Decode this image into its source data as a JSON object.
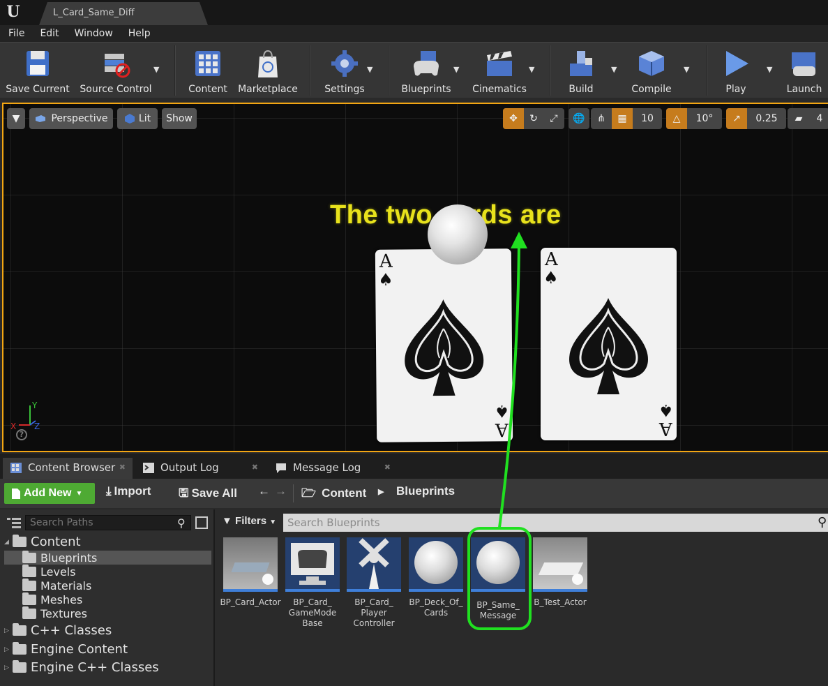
{
  "window": {
    "doc_tab": "L_Card_Same_Diff"
  },
  "menu": [
    "File",
    "Edit",
    "Window",
    "Help"
  ],
  "toolbar": {
    "save_current": "Save Current",
    "source_control": "Source Control",
    "content": "Content",
    "marketplace": "Marketplace",
    "settings": "Settings",
    "blueprints": "Blueprints",
    "cinematics": "Cinematics",
    "build": "Build",
    "compile": "Compile",
    "play": "Play",
    "launch": "Launch"
  },
  "viewport": {
    "perspective": "Perspective",
    "lit": "Lit",
    "show": "Show",
    "grid_snap": "10",
    "rot_snap": "10°",
    "scale_snap": "0.25",
    "cam_speed": "4",
    "world_text": "The two cards are",
    "card_left_rank": "A",
    "card_right_rank": "A",
    "axis_x": "X",
    "axis_y": "Y",
    "axis_z": "Z",
    "help": "?"
  },
  "panel_tabs": [
    "Content Browser",
    "Output Log",
    "Message Log"
  ],
  "cb_toolbar": {
    "add_new": "Add New",
    "import": "Import",
    "save_all": "Save All",
    "path": [
      "Content",
      "Blueprints"
    ]
  },
  "sources": {
    "search_placeholder": "Search Paths",
    "tree": [
      "Content",
      "Blueprints",
      "Levels",
      "Materials",
      "Meshes",
      "Textures",
      "C++ Classes",
      "Engine Content",
      "Engine C++ Classes"
    ]
  },
  "assets": {
    "filters": "Filters",
    "search_placeholder": "Search Blueprints",
    "items": [
      {
        "l1": "BP_Card_Actor",
        "l2": "",
        "l3": ""
      },
      {
        "l1": "BP_Card_",
        "l2": "GameMode",
        "l3": "Base"
      },
      {
        "l1": "BP_Card_",
        "l2": "Player",
        "l3": "Controller"
      },
      {
        "l1": "BP_Deck_Of_",
        "l2": "Cards",
        "l3": ""
      },
      {
        "l1": "BP_Same_",
        "l2": "Message",
        "l3": ""
      },
      {
        "l1": "B_Test_Actor",
        "l2": "",
        "l3": ""
      }
    ]
  },
  "colors": {
    "accent_orange": "#f3a613",
    "add_new_green": "#4eaa33",
    "annotation_green": "#20e020",
    "world_text_yellow": "#e8e21c"
  }
}
